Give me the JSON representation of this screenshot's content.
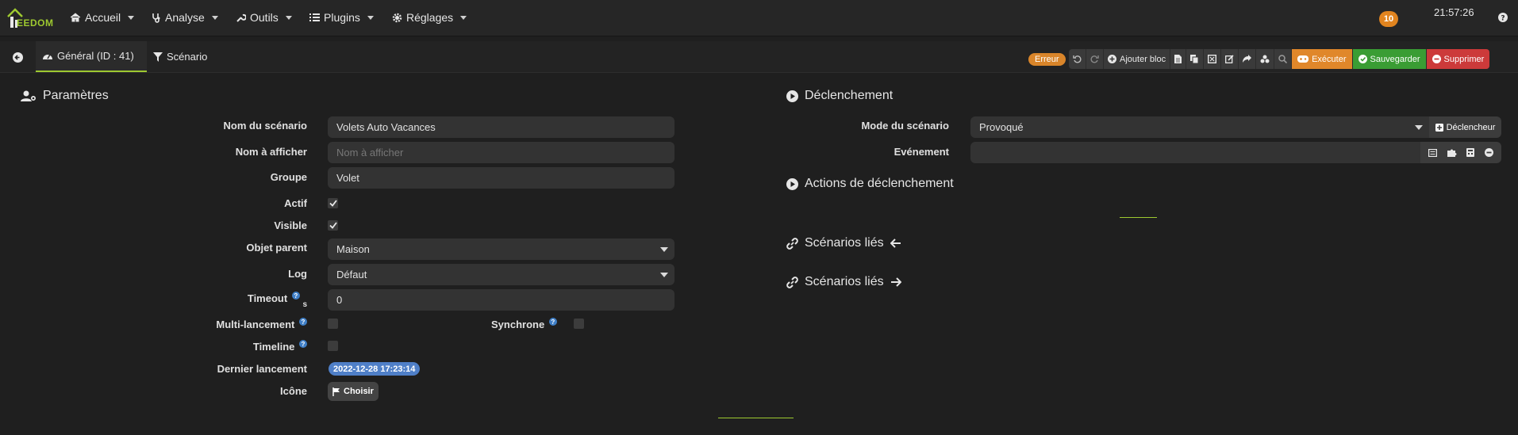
{
  "nav": {
    "logo_text": "EEDOM",
    "items": [
      {
        "label": "Accueil",
        "icon": "home-icon"
      },
      {
        "label": "Analyse",
        "icon": "stethoscope-icon"
      },
      {
        "label": "Outils",
        "icon": "wrench-icon"
      },
      {
        "label": "Plugins",
        "icon": "list-icon"
      },
      {
        "label": "Réglages",
        "icon": "gear-icon"
      }
    ],
    "notification_count": "10",
    "clock": "21:57:26"
  },
  "tabs": {
    "general": "Général (ID : 41)",
    "scenario": "Scénario"
  },
  "toolbar": {
    "erreur": "Erreur",
    "add_block": "Ajouter bloc",
    "execute": "Exécuter",
    "save": "Sauvegarder",
    "delete": "Supprimer"
  },
  "colors": {
    "accent": "#9ec930",
    "execute": "#e0872a",
    "save": "#3a9d34",
    "delete": "#cc3a3a",
    "date_badge": "#4f7fc7"
  },
  "params": {
    "title": "Paramètres",
    "name_label": "Nom du scénario",
    "name_value": "Volets Auto Vacances",
    "display_label": "Nom à afficher",
    "display_placeholder": "Nom à afficher",
    "group_label": "Groupe",
    "group_value": "Volet",
    "active_label": "Actif",
    "visible_label": "Visible",
    "parent_label": "Objet parent",
    "parent_value": "Maison",
    "log_label": "Log",
    "log_value": "Défaut",
    "timeout_label": "Timeout",
    "timeout_unit": "s",
    "timeout_value": "0",
    "multi_label": "Multi-lancement",
    "sync_label": "Synchrone",
    "timeline_label": "Timeline",
    "last_run_label": "Dernier lancement",
    "last_run_value": "2022-12-28 17:23:14",
    "icon_label": "Icône",
    "choose_label": "Choisir"
  },
  "trigger": {
    "title": "Déclenchement",
    "mode_label": "Mode du scénario",
    "mode_value": "Provoqué",
    "trigger_btn": "Déclencheur",
    "event_label": "Evénement",
    "actions_title": "Actions de déclenchement",
    "linked_in": "Scénarios liés",
    "linked_out": "Scénarios liés"
  }
}
